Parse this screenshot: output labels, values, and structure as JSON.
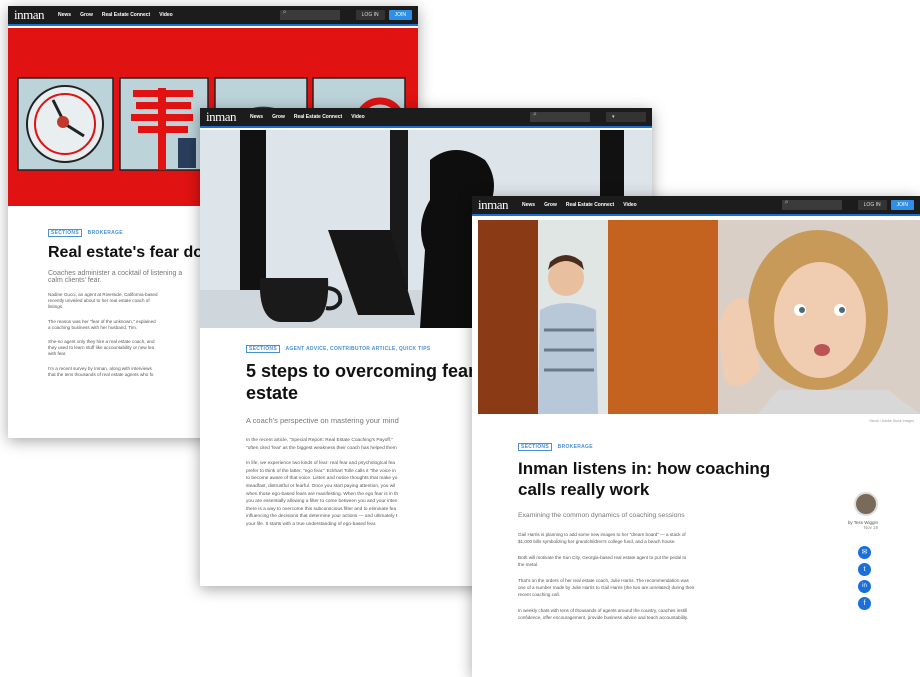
{
  "nav": {
    "logo": "inman",
    "links": [
      "News",
      "Grow",
      "Real Estate Connect",
      "Video"
    ],
    "login": "LOG IN",
    "join": "JOIN",
    "search_icon": "search-icon"
  },
  "articles": [
    {
      "tag_section": "SECTIONS",
      "tags": "BROKERAGE",
      "headline": "Real estate's fear do",
      "dek": "Coaches administer a cocktail of listening a",
      "dek2": "calm clients' fear.",
      "paragraphs": [
        "Nadine Gucci, an agent at Riverside, California-based",
        "recently unveiled about to her real estate coach of",
        "listings.",
        "The reason was her \"fear of the unknown,\" explained",
        "a coaching business with her husband, Tim.",
        "She-no agent only they hire a real estate coach, and",
        "they used to learn stuff like accountability or new lea",
        "with fear.",
        "I'm a recent survey by Inman, along with interviews",
        "that the tens thousands of real estate agents who fo"
      ]
    },
    {
      "tag_section": "SECTIONS",
      "tags": "AGENT ADVICE, CONTRIBUTOR ARTICLE, QUICK TIPS",
      "headline_line1": "5 steps to overcoming fear",
      "headline_line2": "estate",
      "dek": "A coach's perspective on mastering your mind",
      "paragraphs": [
        "In the recent article, \"Special Report: Real Estate Coaching's Payoff,\"",
        "\"often cited 'fear' as the biggest weakness their coach has helped them",
        "In life, we experience two kinds of fear: real fear and psychological fea",
        "prefer to think of the latter, \"ego fear.\" Eckhart Tolle calls it \"the voice in",
        "to become aware of that voice. Listen and notice thoughts that make yo",
        "steadfast, distrustful or fearful. Once you start paying attention, you wil",
        "when those ego-based fears are manifesting. When the ego fear is in th",
        "you are essentially allowing a filter to come between you and your inten",
        "there is a way to overcome this subconscious filter and to eliminate fea",
        "influencing the decisions that determine your actions — and ultimately t",
        "your life. It starts with a true understanding of ego-based fear."
      ]
    },
    {
      "tag_section": "SECTIONS",
      "tags": "BROKERAGE",
      "headline_line1": "Inman listens in: how coaching",
      "headline_line2": "calls really work",
      "dek": "Examining the common dynamics of coaching sessions",
      "photo_credit": "iStock / Adobe Stock Images",
      "author": "by Tess Wiggin",
      "date": "Nov 19",
      "paragraphs": [
        "Gail Harris is planning to add some new images to her \"dream board\" — a stack of",
        "$1,000 bills symbolizing her grandchildren's college fund, and a beach house.",
        "Both will motivate the Sun City, Georgia-based real estate agent to put the pedal to",
        "the metal.",
        "That's on the orders of her real estate coach, Julie Harris. The recommendation was",
        "one of a number made by Julie Harris to Gail Harris (the two are unrelated) during their",
        "recent coaching call.",
        "In weekly chats with tens of thousands of agents around the country, coaches instill",
        "confidence, offer encouragement, provide business advice and teach accountability."
      ],
      "share_icons": [
        "email-icon",
        "twitter-icon",
        "linkedin-icon",
        "facebook-icon"
      ]
    }
  ],
  "colors": {
    "nav_bg": "#1c1c1c",
    "accent_blue": "#2d8fe8",
    "hero_red": "#e01212"
  }
}
